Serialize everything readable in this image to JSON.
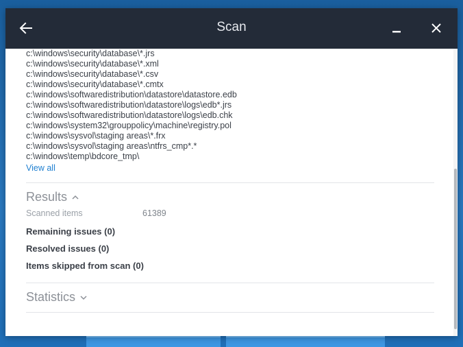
{
  "window": {
    "title": "Scan"
  },
  "exclusion_paths": [
    "c:\\windows\\security\\database\\*.jrs",
    "c:\\windows\\security\\database\\*.xml",
    "c:\\windows\\security\\database\\*.csv",
    "c:\\windows\\security\\database\\*.cmtx",
    "c:\\windows\\softwaredistribution\\datastore\\datastore.edb",
    "c:\\windows\\softwaredistribution\\datastore\\logs\\edb*.jrs",
    "c:\\windows\\softwaredistribution\\datastore\\logs\\edb.chk",
    "c:\\windows\\system32\\grouppolicy\\machine\\registry.pol",
    "c:\\windows\\sysvol\\staging areas\\*.frx",
    "c:\\windows\\sysvol\\staging areas\\ntfrs_cmp*.*",
    "c:\\windows\\temp\\bdcore_tmp\\"
  ],
  "view_all_label": "View all",
  "results": {
    "heading": "Results",
    "scanned_label": "Scanned items",
    "scanned_value": "61389",
    "remaining": "Remaining issues (0)",
    "resolved": "Resolved issues (0)",
    "skipped": "Items skipped from scan (0)"
  },
  "statistics": {
    "heading": "Statistics"
  },
  "icons": {
    "back": "arrow-left-icon",
    "minimize": "minimize-icon",
    "close": "close-icon",
    "results_chevron": "chevron-up-icon",
    "statistics_chevron": "chevron-down-icon"
  },
  "colors": {
    "titlebar": "#232b38",
    "link": "#1e7fd0"
  }
}
